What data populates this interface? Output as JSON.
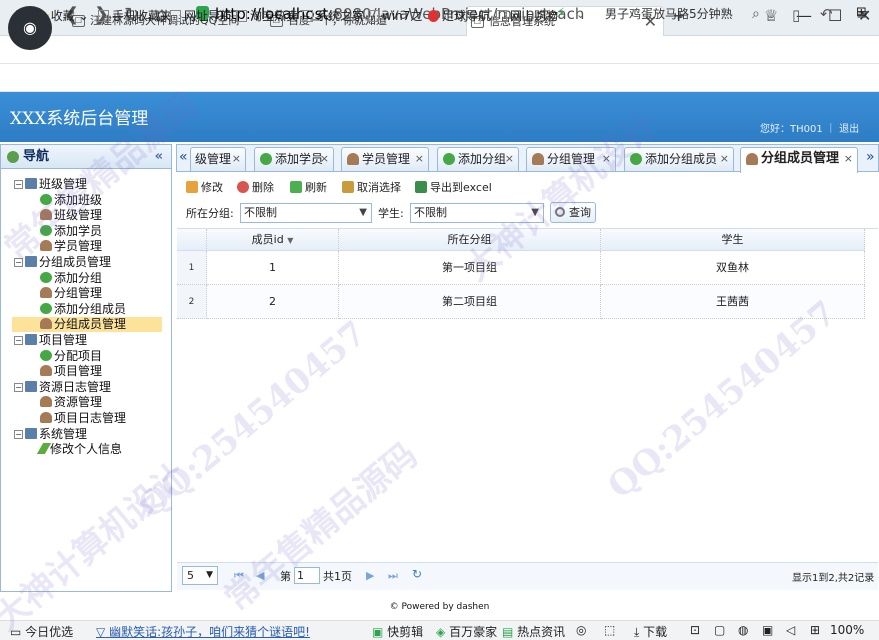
{
  "browser": {
    "tabs": [
      {
        "label": "汪建林源码大神调试的QQ空间"
      },
      {
        "label": "百度一下，你就知道"
      },
      {
        "label": "信息管理系统"
      }
    ],
    "url_host": "http://localhost",
    "url_rest": ":8080/JavaWebProject/main_teach",
    "search_query": "男子鸡蛋放马路5分钟熟",
    "bookmarks": [
      "收藏",
      "手机收藏夹",
      "网址导航",
      "淘宝热卖",
      "系统之家",
      "win7之",
      "足球导航",
      "网上购物"
    ]
  },
  "app": {
    "title": "XXX系统后台管理",
    "user_text": "您好：TH001 ｜ 退出"
  },
  "nav": {
    "header": "导航",
    "tree": [
      {
        "label": "班级管理",
        "level": 0,
        "icon": "computer-icon"
      },
      {
        "label": "添加班级",
        "level": 1,
        "icon": "add-icon"
      },
      {
        "label": "班级管理",
        "level": 1,
        "icon": "user-icon"
      },
      {
        "label": "添加学员",
        "level": 1,
        "icon": "add-icon"
      },
      {
        "label": "学员管理",
        "level": 1,
        "icon": "user-icon"
      },
      {
        "label": "分组成员管理",
        "level": 0,
        "icon": "computer-icon"
      },
      {
        "label": "添加分组",
        "level": 1,
        "icon": "add-icon"
      },
      {
        "label": "分组管理",
        "level": 1,
        "icon": "user-icon"
      },
      {
        "label": "添加分组成员",
        "level": 1,
        "icon": "add-icon"
      },
      {
        "label": "分组成员管理",
        "level": 1,
        "icon": "user-icon",
        "selected": true
      },
      {
        "label": "项目管理",
        "level": 0,
        "icon": "computer-icon"
      },
      {
        "label": "分配项目",
        "level": 1,
        "icon": "add-icon"
      },
      {
        "label": "项目管理",
        "level": 1,
        "icon": "user-icon"
      },
      {
        "label": "资源日志管理",
        "level": 0,
        "icon": "computer-icon"
      },
      {
        "label": "资源管理",
        "level": 1,
        "icon": "user-icon"
      },
      {
        "label": "项目日志管理",
        "level": 1,
        "icon": "user-icon"
      },
      {
        "label": "系统管理",
        "level": 0,
        "icon": "computer-icon"
      },
      {
        "label": "修改个人信息",
        "level": 1,
        "icon": "pencil-icon"
      }
    ]
  },
  "main_tabs": [
    {
      "label": "级管理"
    },
    {
      "label": "添加学员"
    },
    {
      "label": "学员管理"
    },
    {
      "label": "添加分组"
    },
    {
      "label": "分组管理"
    },
    {
      "label": "添加分组成员"
    },
    {
      "label": "分组成员管理",
      "active": true
    }
  ],
  "toolbar": {
    "edit": "修改",
    "delete": "删除",
    "refresh": "刷新",
    "cancel_select": "取消选择",
    "export": "导出到excel"
  },
  "filter": {
    "group_label": "所在分组:",
    "group_value": "不限制",
    "student_label": "学生:",
    "student_value": "不限制",
    "query": "查询"
  },
  "grid": {
    "headers": [
      "成员id",
      "所在分组",
      "学生"
    ],
    "rows": [
      {
        "rownum": "1",
        "id": "1",
        "group": "第一项目组",
        "student": "双鱼林"
      },
      {
        "rownum": "2",
        "id": "2",
        "group": "第二项目组",
        "student": "王茜茜"
      }
    ]
  },
  "pager": {
    "page_size": "5",
    "page_prefix": "第",
    "page_value": "1",
    "page_suffix": "共1页",
    "summary": "显示1到2,共2记录"
  },
  "footer": "© Powered by dashen",
  "statusbar": {
    "left": "今日优选",
    "news": "幽默笑话:孩孙子，咱们来猜个谜语吧!",
    "items": [
      "快剪辑",
      "百万豪家",
      "热点资讯",
      "下载",
      "100%"
    ]
  },
  "watermark": [
    "常年售精品源码",
    "QQ:254540457",
    "大神计算机设计",
    "QQ:254540457",
    "常年售精品源码",
    "大神计算机设计"
  ]
}
